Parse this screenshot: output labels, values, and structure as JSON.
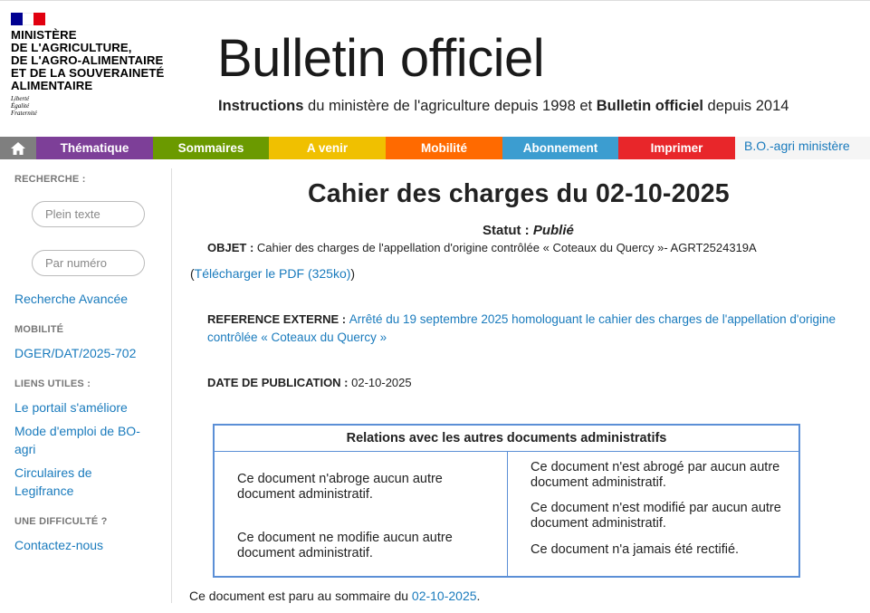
{
  "header": {
    "ministry_lines": [
      "MINISTÈRE",
      "DE L'AGRICULTURE,",
      "DE L'AGRO-ALIMENTAIRE",
      "ET DE LA SOUVERAINETÉ",
      "ALIMENTAIRE"
    ],
    "motto": [
      "Liberté",
      "Égalité",
      "Fraternité"
    ],
    "title": "Bulletin officiel",
    "subtitle": {
      "part1_bold": "Instructions",
      "part2": " du ministère de l'agriculture depuis 1998 et ",
      "part3_bold": "Bulletin officiel",
      "part4": " depuis 2014"
    },
    "flag_colors": [
      "#000091",
      "#ffffff",
      "#e1000f"
    ]
  },
  "nav": {
    "home_icon": "home-icon",
    "items": [
      {
        "label": "Thématique",
        "color": "#7d3f98"
      },
      {
        "label": "Sommaires",
        "color": "#6b9a00"
      },
      {
        "label": "A venir",
        "color": "#f0c000"
      },
      {
        "label": "Mobilité",
        "color": "#ff6a00"
      },
      {
        "label": "Abonnement",
        "color": "#3c9dd0"
      },
      {
        "label": "Imprimer",
        "color": "#e8262a"
      }
    ],
    "last_link": "B.O.-agri ministère"
  },
  "sidebar": {
    "search_heading": "RECHERCHE :",
    "fulltext_placeholder": "Plein texte",
    "number_placeholder": "Par numéro",
    "advanced_search": "Recherche Avancée",
    "mobility_heading": "MOBILITÉ",
    "mobility_link": "DGER/DAT/2025-702",
    "useful_heading": "LIENS UTILES :",
    "useful_links": [
      "Le portail s'améliore",
      "Mode d'emploi de BO-agri",
      "Circulaires de Legifrance"
    ],
    "difficulty_heading": "UNE DIFFICULTÉ ?",
    "contact_link": "Contactez-nous"
  },
  "document": {
    "title": "Cahier des charges du 02-10-2025",
    "status_label": "Statut : ",
    "status_value": "Publié",
    "object_label": "OBJET : ",
    "object_value": "Cahier des charges de l'appellation d'origine contrôlée « Coteaux du Quercy »- AGRT2524319A",
    "pdf_open": "(",
    "pdf_link": "Télécharger le PDF (325ko)",
    "pdf_close": ")",
    "ref_label": "REFERENCE EXTERNE : ",
    "ref_link": "Arrêté du 19 septembre 2025 homologuant le cahier des charges de l'appellation d'origine contrôlée « Coteaux du Quercy »",
    "date_label": "DATE DE PUBLICATION : ",
    "date_value": "02-10-2025"
  },
  "relations": {
    "title": "Relations avec les autres documents administratifs",
    "left": [
      "Ce document n'abroge aucun autre document administratif.",
      "Ce document ne modifie aucun autre document administratif."
    ],
    "right": [
      "Ce document n'est abrogé par aucun autre document administratif.",
      "Ce document n'est modifié par aucun autre document administratif.",
      "Ce document n'a jamais été rectifié."
    ]
  },
  "footer": {
    "text": "Ce document est paru au sommaire du ",
    "link": "02-10-2025",
    "end": "."
  }
}
